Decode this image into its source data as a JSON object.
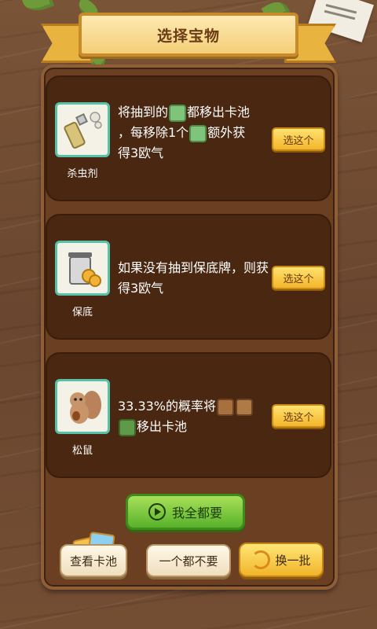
{
  "header": {
    "title": "选择宝物"
  },
  "cards": [
    {
      "name": "杀虫剂",
      "desc_parts": [
        "将抽到的",
        "都移出卡池",
        "，每移除1个",
        "额外获",
        "得3欧气"
      ],
      "button": "选这个",
      "icon": "spray-bottle-icon"
    },
    {
      "name": "保底",
      "desc_parts": [
        "如果没有抽到保底牌，则获得3欧气"
      ],
      "button": "选这个",
      "icon": "trash-can-coins-icon"
    },
    {
      "name": "松鼠",
      "desc_parts": [
        "33.33%的概率将",
        "移出卡池"
      ],
      "button": "选这个",
      "icon": "squirrel-icon"
    }
  ],
  "actions": {
    "take_all": "我全都要",
    "view_pool": "查看卡池",
    "take_none": "一个都不要",
    "refresh": "换一批"
  },
  "colors": {
    "accent_green": "#58b22a",
    "accent_yellow": "#f3b52a",
    "card_bg": "#4a2710"
  }
}
